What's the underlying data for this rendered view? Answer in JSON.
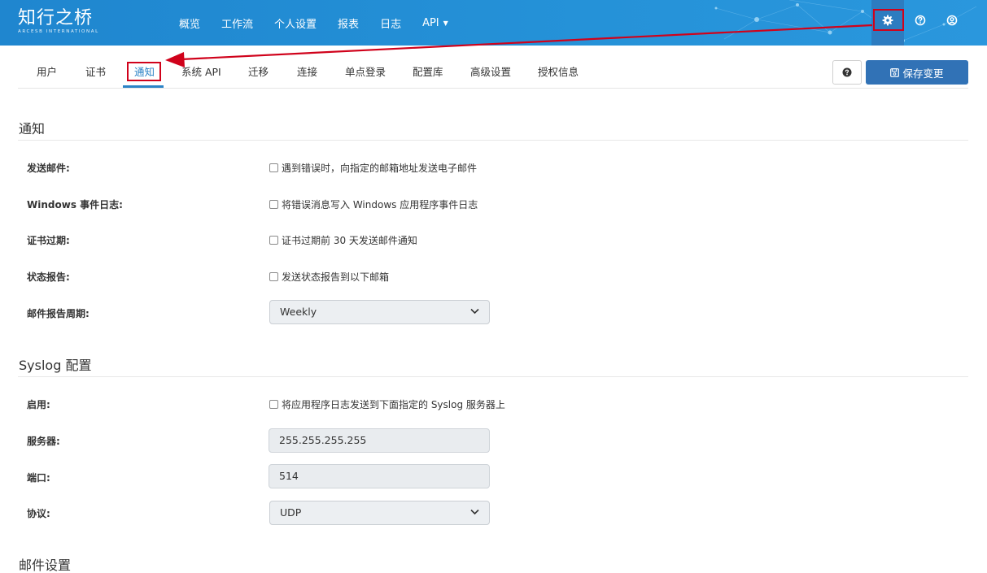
{
  "header": {
    "logo_text": "知行之桥",
    "logo_subtext": "ARCESB INTERNATIONAL",
    "nav": [
      "概览",
      "工作流",
      "个人设置",
      "报表",
      "日志",
      "API"
    ],
    "icons": [
      "gear-icon",
      "help-circle-icon",
      "user-circle-icon"
    ]
  },
  "tabs": [
    "用户",
    "证书",
    "通知",
    "系统 API",
    "迁移",
    "连接",
    "单点登录",
    "配置库",
    "高级设置",
    "授权信息"
  ],
  "active_tab": "通知",
  "toolbar": {
    "save_label": "保存变更",
    "help_icon": "question-circle-icon"
  },
  "notifications": {
    "title": "通知",
    "email_label": "发送邮件:",
    "email_checkbox": "遇到错误时，向指定的邮箱地址发送电子邮件",
    "winlog_label": "Windows 事件日志:",
    "winlog_checkbox": "将错误消息写入 Windows 应用程序事件日志",
    "cert_label": "证书过期:",
    "cert_checkbox": "证书过期前 30 天发送邮件通知",
    "status_label": "状态报告:",
    "status_checkbox": "发送状态报告到以下邮箱",
    "period_label": "邮件报告周期:",
    "period_value": "Weekly"
  },
  "syslog": {
    "title": "Syslog 配置",
    "enable_label": "启用:",
    "enable_checkbox": "将应用程序日志发送到下面指定的 Syslog 服务器上",
    "server_label": "服务器:",
    "server_value": "255.255.255.255",
    "port_label": "端口:",
    "port_value": "514",
    "protocol_label": "协议:",
    "protocol_value": "UDP"
  },
  "mail": {
    "title": "邮件设置"
  },
  "colors": {
    "header": "#2592d8",
    "accent": "#2b83c6",
    "save_button": "#3172b6",
    "annotation": "#d0021b"
  }
}
